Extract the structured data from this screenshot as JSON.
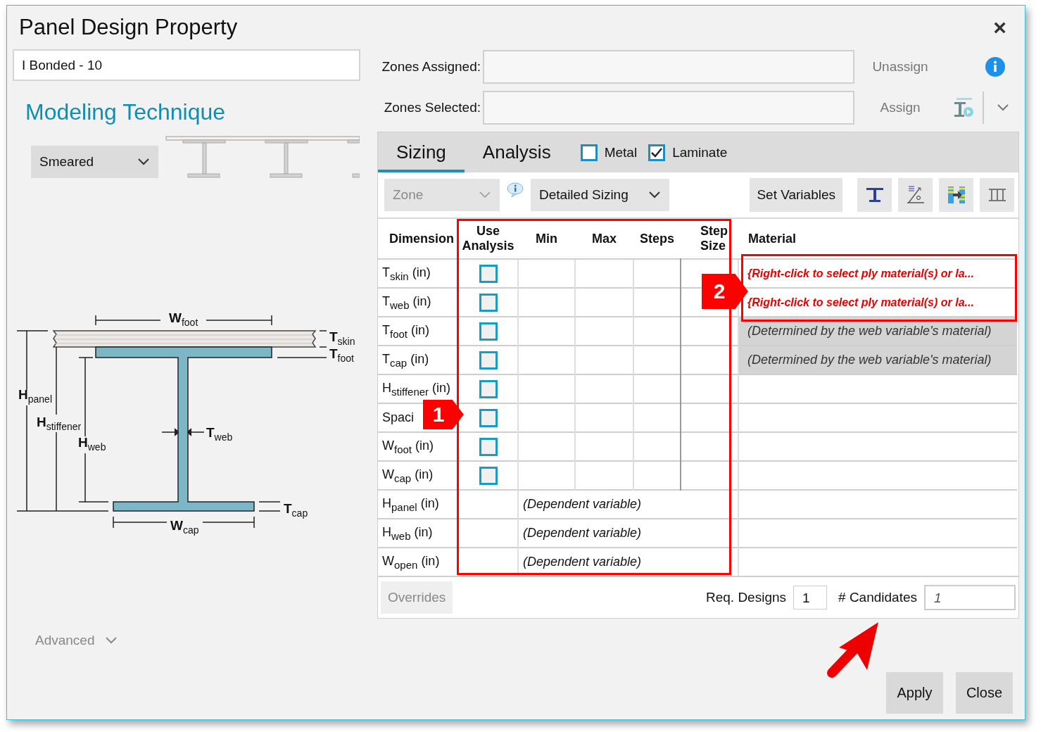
{
  "window": {
    "title": "Panel Design Property",
    "close": "×"
  },
  "name_field": {
    "value": "I Bonded - 10"
  },
  "modeling_technique": {
    "heading": "Modeling Technique",
    "dropdown": {
      "value": "Smeared"
    }
  },
  "diagram": {
    "labels": [
      {
        "symbol": "W",
        "sub": "foot"
      },
      {
        "symbol": "T",
        "sub": "skin"
      },
      {
        "symbol": "T",
        "sub": "foot"
      },
      {
        "symbol": "H",
        "sub": "panel"
      },
      {
        "symbol": "H",
        "sub": "stiffener"
      },
      {
        "symbol": "H",
        "sub": "web"
      },
      {
        "symbol": "T",
        "sub": "web"
      },
      {
        "symbol": "T",
        "sub": "cap"
      },
      {
        "symbol": "W",
        "sub": "cap"
      }
    ]
  },
  "advanced": {
    "label": "Advanced",
    "expanded": false
  },
  "zones": [
    {
      "label": "Zones Assigned:",
      "action": "Unassign"
    },
    {
      "label": "Zones Selected:",
      "action": "Assign"
    }
  ],
  "tabs": [
    {
      "label": "Sizing",
      "selected": true
    },
    {
      "label": "Analysis",
      "selected": false
    }
  ],
  "options": [
    {
      "label": "Metal",
      "checked": false
    },
    {
      "label": "Laminate",
      "checked": true
    }
  ],
  "toolbar": {
    "zone": {
      "value": "Zone",
      "disabled": true
    },
    "mode": {
      "value": "Detailed Sizing"
    },
    "set_variables": "Set Variables"
  },
  "table": {
    "columns": [
      "Dimension",
      "Use Analysis",
      "Min",
      "Max",
      "Steps",
      "Step Size",
      "Material"
    ],
    "rows": [
      {
        "dimension": "T$_{skin}$ (in)",
        "kind": "variable",
        "use_analysis": false,
        "material": {
          "kind": "prompt",
          "text": "{Right-click to select ply material(s) or la..."
        }
      },
      {
        "dimension": "T$_{web}$ (in)",
        "kind": "variable",
        "use_analysis": false,
        "material": {
          "kind": "prompt",
          "text": "{Right-click to select ply material(s) or la..."
        }
      },
      {
        "dimension": "T$_{foot}$ (in)",
        "kind": "variable",
        "use_analysis": false,
        "material": {
          "kind": "determined",
          "text": "(Determined by the web variable's material)"
        }
      },
      {
        "dimension": "T$_{cap}$ (in)",
        "kind": "variable",
        "use_analysis": false,
        "material": {
          "kind": "determined",
          "text": "(Determined by the web variable's material)"
        }
      },
      {
        "dimension": "H$_{stiffener}$ (in)",
        "kind": "variable",
        "use_analysis": false
      },
      {
        "dimension": "Spaci",
        "kind": "variable",
        "use_analysis": false
      },
      {
        "dimension": "W$_{foot}$ (in)",
        "kind": "variable",
        "use_analysis": false
      },
      {
        "dimension": "W$_{cap}$ (in)",
        "kind": "variable",
        "use_analysis": false
      },
      {
        "dimension": "H$_{panel}$ (in)",
        "kind": "dependent",
        "note": "(Dependent variable)"
      },
      {
        "dimension": "H$_{web}$ (in)",
        "kind": "dependent",
        "note": "(Dependent variable)"
      },
      {
        "dimension": "W$_{open}$ (in)",
        "kind": "dependent",
        "note": "(Dependent variable)"
      }
    ]
  },
  "footer": {
    "overrides": "Overrides",
    "req_designs": {
      "label": "Req. Designs",
      "value": "1"
    },
    "candidates": {
      "label": "# Candidates",
      "value": "1"
    }
  },
  "buttons": [
    "Apply",
    "Close"
  ],
  "annotations": [
    {
      "label": "1"
    },
    {
      "label": "2"
    }
  ]
}
